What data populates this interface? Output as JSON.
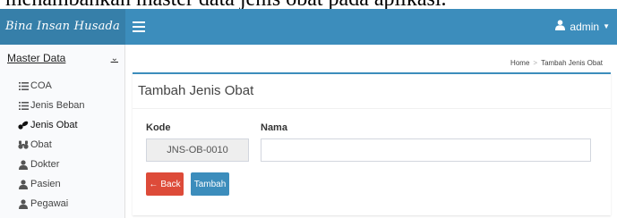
{
  "document": {
    "caption_text": "menambahkan master data jenis obat pada aplikasi."
  },
  "header": {
    "brand": "Bina Insan Husada",
    "user_label": "admin",
    "menu_icon": "hamburger-icon",
    "user_icon": "user-icon"
  },
  "sidebar": {
    "section_label": "Master Data",
    "items": [
      {
        "label": "COA",
        "icon": "list-icon"
      },
      {
        "label": "Jenis Beban",
        "icon": "list-icon"
      },
      {
        "label": "Jenis Obat",
        "icon": "pills-icon",
        "active": true
      },
      {
        "label": "Obat",
        "icon": "binoculars-icon"
      },
      {
        "label": "Dokter",
        "icon": "user-icon"
      },
      {
        "label": "Pasien",
        "icon": "user-icon"
      },
      {
        "label": "Pegawai",
        "icon": "user-icon"
      }
    ]
  },
  "breadcrumb": {
    "home": "Home",
    "current": "Tambah Jenis Obat"
  },
  "form": {
    "title": "Tambah Jenis Obat",
    "kode_label": "Kode",
    "kode_value": "JNS-OB-0010",
    "nama_label": "Nama",
    "nama_value": "",
    "back_label": "Back",
    "submit_label": "Tambah"
  },
  "colors": {
    "topbar": "#3c8dbc",
    "brand_bg": "#367fa9",
    "back_button": "#dd4b39",
    "submit_button": "#3c8dbc"
  }
}
